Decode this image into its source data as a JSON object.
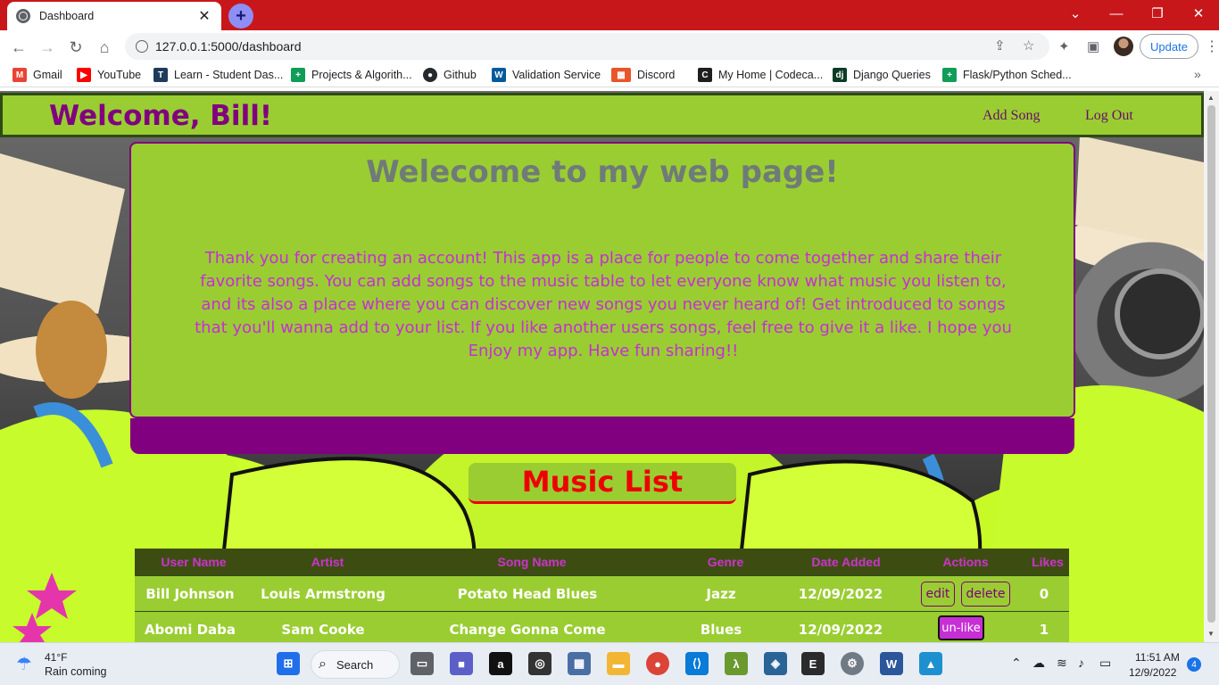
{
  "browser": {
    "tab_title": "Dashboard",
    "url": "127.0.0.1:5000/dashboard",
    "update_label": "Update",
    "bookmarks": [
      {
        "label": "Gmail",
        "icon": "gmail-icon",
        "color": "#ea4335"
      },
      {
        "label": "YouTube",
        "icon": "youtube-icon",
        "color": "#ff0000"
      },
      {
        "label": "Learn - Student Das...",
        "icon": "learn-icon",
        "color": "#1f3b5c"
      },
      {
        "label": "Projects & Algorith...",
        "icon": "projects-icon",
        "color": "#0f9d58"
      },
      {
        "label": "Github",
        "icon": "github-icon",
        "color": "#24292e"
      },
      {
        "label": "Validation Service",
        "icon": "w3c-icon",
        "color": "#005a9c"
      },
      {
        "label": "Discord",
        "icon": "discord-icon",
        "color": "#e8552a"
      },
      {
        "label": "My Home | Codeca...",
        "icon": "codecademy-icon",
        "color": "#1f1f1f"
      },
      {
        "label": "Django Queries",
        "icon": "django-icon",
        "color": "#0c3c26"
      },
      {
        "label": "Flask/Python Sched...",
        "icon": "flask-icon",
        "color": "#0f9d58"
      }
    ]
  },
  "app": {
    "welcome_user": "Welcome, Bill!",
    "nav": {
      "add_song": "Add Song",
      "log_out": "Log Out"
    },
    "intro": {
      "title": "Welecome to my web page!",
      "text": "Thank you for creating an account! This app is a place for people to come together and share their favorite songs. You can add songs to the music table to let everyone know what music you listen to, and its also a place where you can discover new songs you never heard of! Get introduced to songs that you'll wanna add to your list. If you like another users songs, feel free to give it a like. I hope you Enjoy my app. Have fun sharing!!"
    },
    "music_list_title": "Music List",
    "table": {
      "headers": [
        "User Name",
        "Artist",
        "Song Name",
        "Genre",
        "Date Added",
        "Actions",
        "Likes"
      ],
      "rows": [
        {
          "user": "Bill Johnson",
          "artist": "Louis Armstrong",
          "song": "Potato Head Blues",
          "genre": "Jazz",
          "date": "12/09/2022",
          "edit": "edit",
          "delete": "delete",
          "likes": "0"
        },
        {
          "user": "Abomi Daba",
          "artist": "Sam Cooke",
          "song": "Change Gonna Come",
          "genre": "Blues",
          "date": "12/09/2022",
          "unlike": "un-like",
          "likes": "1"
        }
      ]
    },
    "colors": {
      "navbar": "#9acd32",
      "accent": "#800080",
      "title_red": "#e00"
    }
  },
  "taskbar": {
    "weather_temp": "41°F",
    "weather_desc": "Rain coming",
    "search_label": "Search",
    "time": "11:51 AM",
    "date": "12/9/2022",
    "notifications": "4"
  }
}
